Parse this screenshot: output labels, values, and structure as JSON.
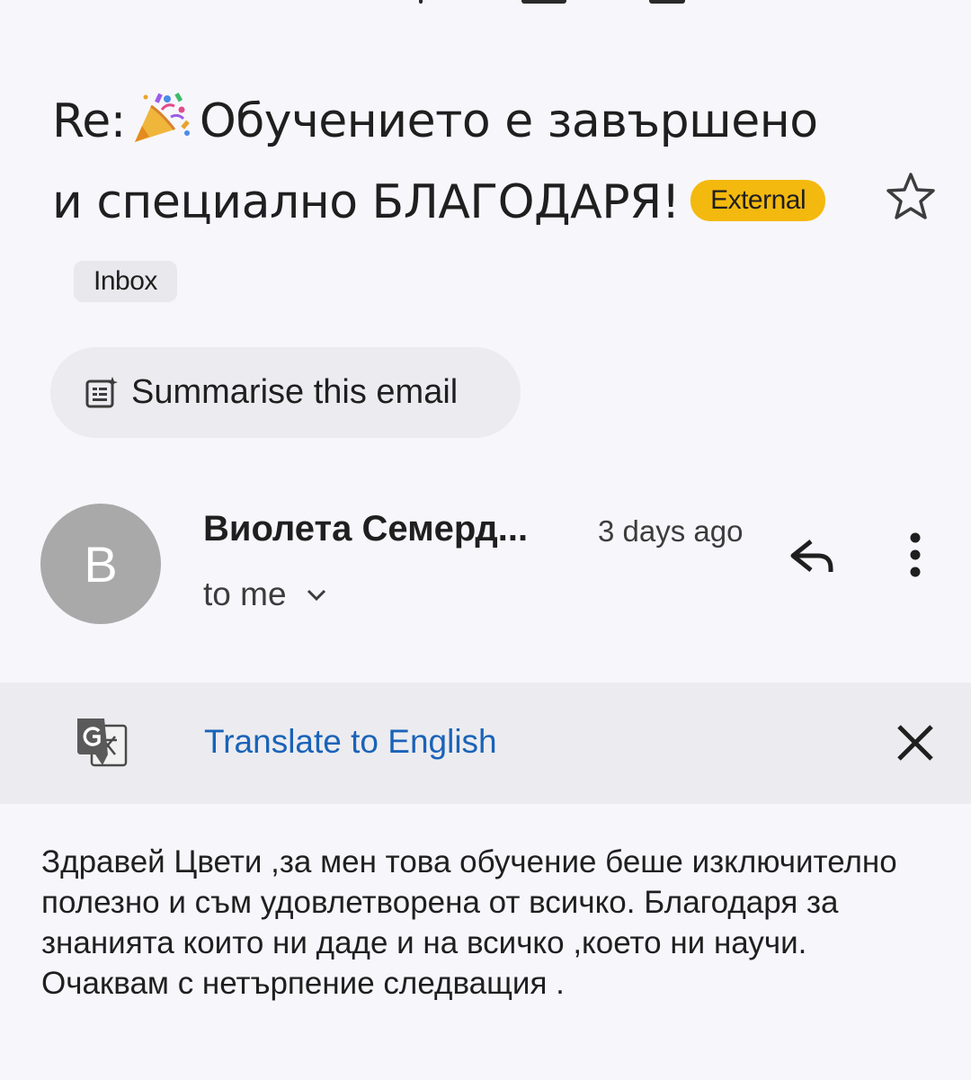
{
  "email": {
    "subject_prefix": "Re:",
    "subject_text": "Обучението е завършено и специално БЛАГОДАРЯ!",
    "labels": {
      "external": "External",
      "inbox": "Inbox"
    },
    "summarise_label": "Summarise this email",
    "sender": {
      "avatar_letter": "В",
      "name": "Виолета Семерд...",
      "time": "3 days ago",
      "recipient": "to me"
    },
    "translate": {
      "label": "Translate to English"
    },
    "body": "Здравей Цвети ,за мен това обучение беше изключително полезно и съм удовлетворена от всичко. Благодаря за знанията които ни даде и на всичко ,което ни научи. Очаквам с нетърпение следващия ."
  },
  "icons": {
    "subject_emoji": "party-popper-icon",
    "star": "star-outline-icon",
    "summarise": "summarise-icon",
    "reply": "reply-icon",
    "more": "more-vert-icon",
    "recipient_expand": "chevron-down-icon",
    "translate": "google-translate-icon",
    "close": "close-icon"
  },
  "colors": {
    "background": "#f7f6fb",
    "external_chip": "#f4b90e",
    "inbox_chip": "#e9e8ec",
    "translate_bar": "#ececf0",
    "link": "#1a63b8",
    "avatar": "#a9a9a9"
  }
}
